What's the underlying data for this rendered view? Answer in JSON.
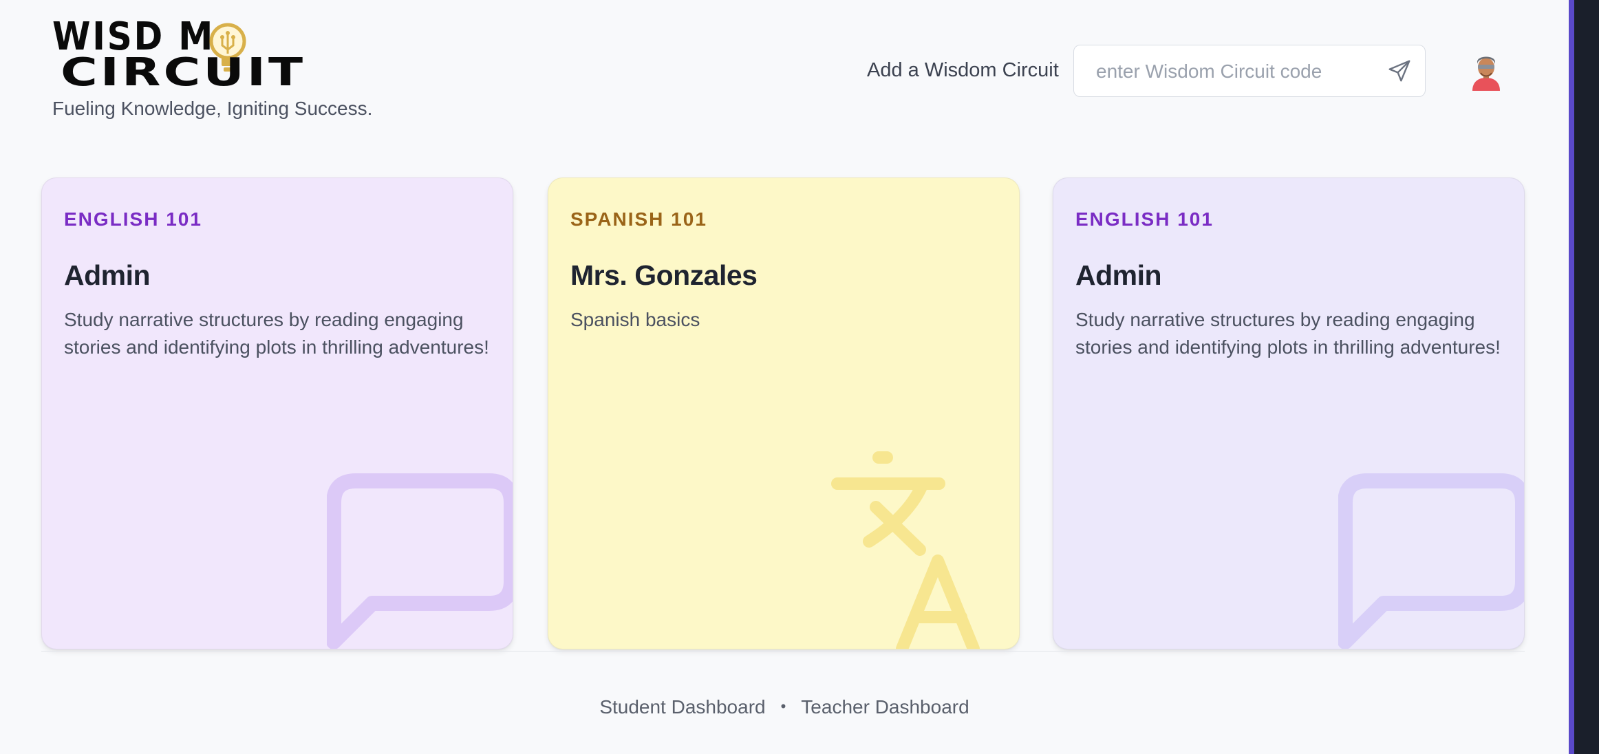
{
  "brand": {
    "logo_line1": "WISD M",
    "logo_line2": "CIRCUIT",
    "tagline": "Fueling Knowledge, Igniting Success."
  },
  "header": {
    "add_label": "Add a Wisdom Circuit",
    "code_placeholder": "enter Wisdom Circuit code",
    "code_value": "",
    "send_icon": "paper-plane-icon",
    "avatar_icon": "user-avatar-icon"
  },
  "cards": [
    {
      "course": "ENGLISH 101",
      "teacher": "Admin",
      "description": "Study narrative structures by reading engaging stories and identifying plots in thrilling adventures!",
      "icon": "speech-bubble-icon",
      "background": "#f1e7fc",
      "accent": "#7a2cc4"
    },
    {
      "course": "SPANISH 101",
      "teacher": "Mrs. Gonzales",
      "description": "Spanish basics",
      "icon": "translate-icon",
      "background": "#fdf8c8",
      "accent": "#9a6418"
    },
    {
      "course": "ENGLISH 101",
      "teacher": "Admin",
      "description": "Study narrative structures by reading engaging stories and identifying plots in thrilling adventures!",
      "icon": "speech-bubble-icon",
      "background": "#ece8fb",
      "accent": "#7a2cc4"
    }
  ],
  "footer": {
    "links": [
      "Student Dashboard",
      "Teacher Dashboard"
    ],
    "separator": "•"
  }
}
